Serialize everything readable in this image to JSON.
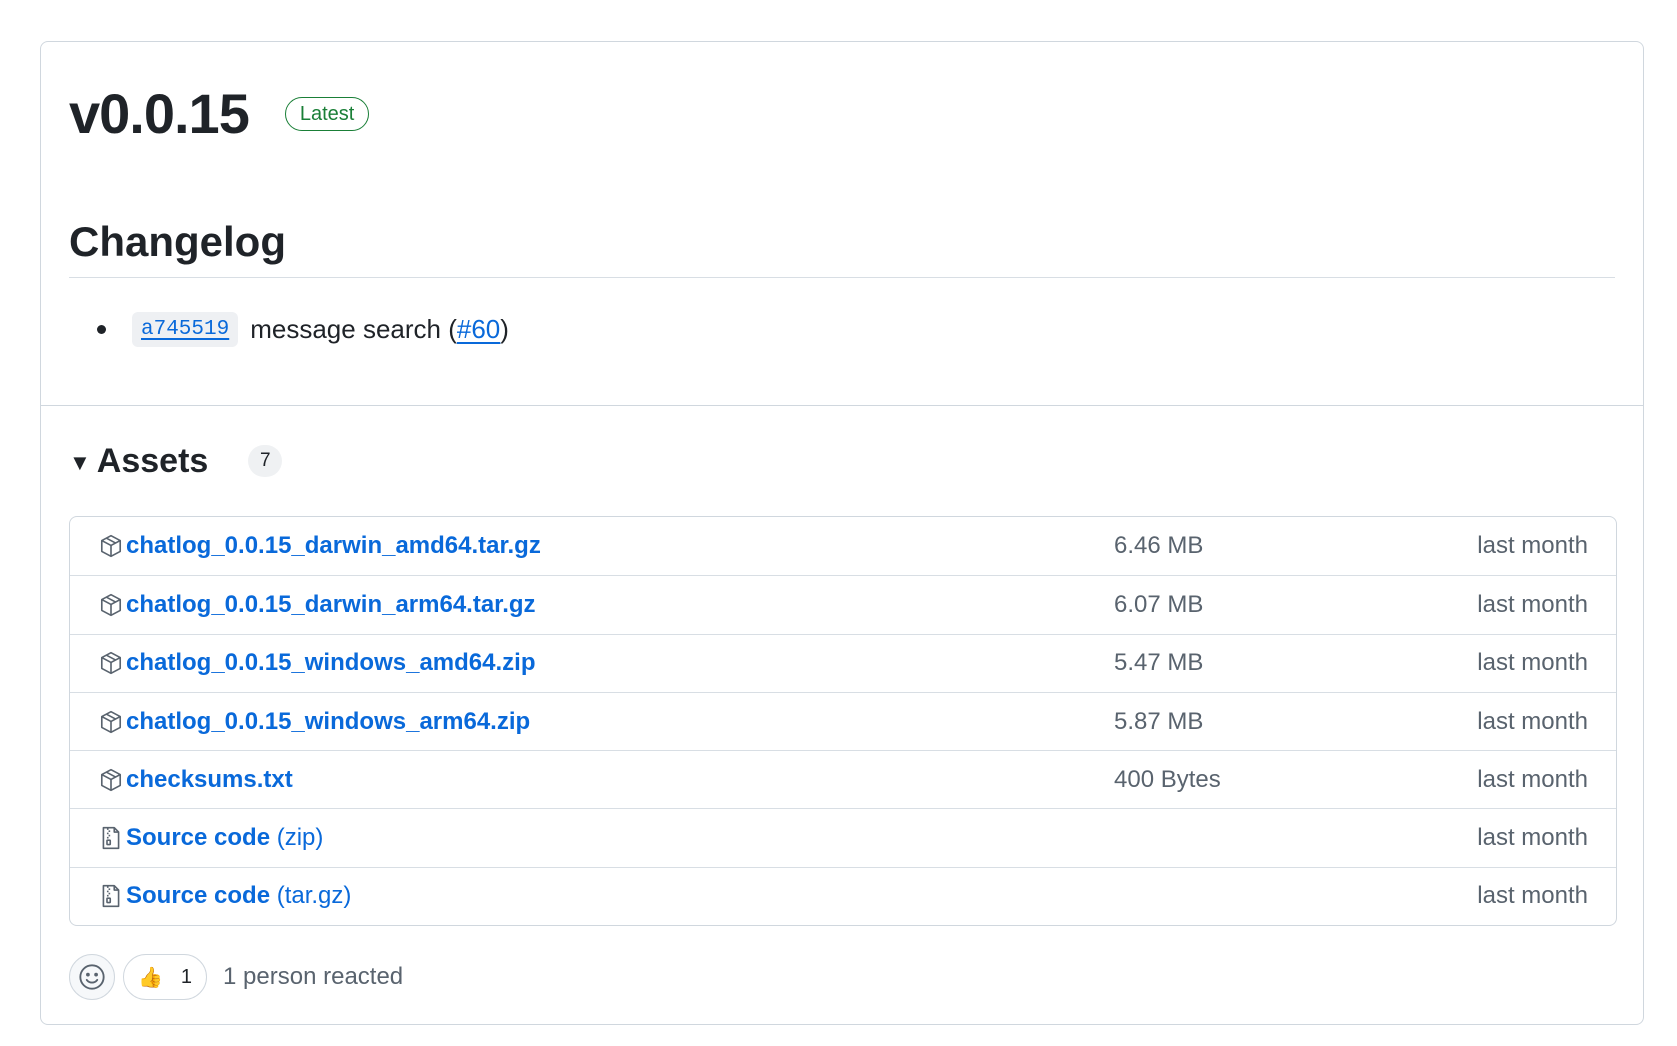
{
  "release": {
    "version": "v0.0.15",
    "badge": "Latest"
  },
  "changelog": {
    "heading": "Changelog",
    "items": [
      {
        "sha": "a745519",
        "text": "message search (",
        "issue": "#60",
        "close": ")"
      }
    ]
  },
  "assets": {
    "title": "Assets",
    "count": "7",
    "rows": [
      {
        "icon": "package-icon",
        "name": "chatlog_0.0.15_darwin_amd64.tar.gz",
        "suffix": "",
        "size": "6.46 MB",
        "date": "last month"
      },
      {
        "icon": "package-icon",
        "name": "chatlog_0.0.15_darwin_arm64.tar.gz",
        "suffix": "",
        "size": "6.07 MB",
        "date": "last month"
      },
      {
        "icon": "package-icon",
        "name": "chatlog_0.0.15_windows_amd64.zip",
        "suffix": "",
        "size": "5.47 MB",
        "date": "last month"
      },
      {
        "icon": "package-icon",
        "name": "chatlog_0.0.15_windows_arm64.zip",
        "suffix": "",
        "size": "5.87 MB",
        "date": "last month"
      },
      {
        "icon": "package-icon",
        "name": "checksums.txt",
        "suffix": "",
        "size": "400 Bytes",
        "date": "last month"
      },
      {
        "icon": "file-zip-icon",
        "name": "Source code",
        "suffix": " (zip)",
        "size": "",
        "date": "last month"
      },
      {
        "icon": "file-zip-icon",
        "name": "Source code",
        "suffix": " (tar.gz)",
        "size": "",
        "date": "last month"
      }
    ]
  },
  "reactions": {
    "emoji_icon": "smiley-icon",
    "thumbs_emoji": "👍",
    "thumbs_count": "1",
    "summary": "1 person reacted"
  },
  "colors": {
    "link": "#0969da",
    "latest": "#1a7f37",
    "muted": "#59636e"
  }
}
